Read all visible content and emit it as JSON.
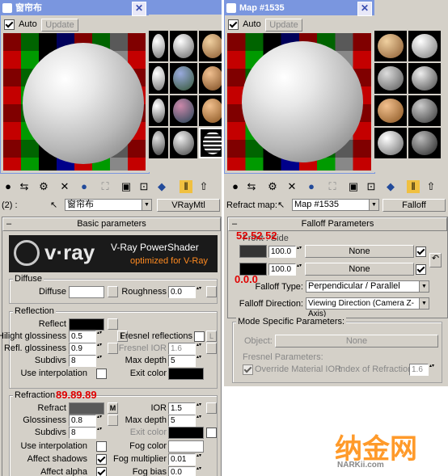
{
  "left": {
    "title": "窗帘布",
    "auto_label": "Auto",
    "update_label": "Update",
    "toolbar_prefix": "(2) :",
    "material_name": "窗帘布",
    "material_type": "VRayMtl",
    "rollout_title": "Basic parameters",
    "vray_banner": {
      "logo": "v·ray",
      "title": "V-Ray PowerShader",
      "subtitle": "optimized for V-Ray"
    },
    "diffuse": {
      "group": "Diffuse",
      "diffuse_label": "Diffuse",
      "roughness_label": "Roughness",
      "roughness": "0.0"
    },
    "reflection": {
      "group": "Reflection",
      "reflect_label": "Reflect",
      "hilight_label": "Hilight glossiness",
      "hilight": "0.5",
      "l_label": "L",
      "fresnel_label": "Fresnel reflections",
      "refl_gloss_label": "Refl. glossiness",
      "refl_gloss": "0.9",
      "fresnel_ior_label": "Fresnel IOR",
      "fresnel_ior": "1.6",
      "subdivs_label": "Subdivs",
      "subdivs": "8",
      "max_depth_label": "Max depth",
      "max_depth": "5",
      "use_interp_label": "Use interpolation",
      "exit_color_label": "Exit color"
    },
    "refraction": {
      "group": "Refraction",
      "annotation": "89.89.89",
      "refract_label": "Refract",
      "m_label": "M",
      "ior_label": "IOR",
      "ior": "1.5",
      "gloss_label": "Glossiness",
      "gloss": "0.8",
      "max_depth_label": "Max depth",
      "max_depth": "5",
      "subdivs_label": "Subdivs",
      "subdivs": "8",
      "exit_color_label": "Exit color",
      "use_interp_label": "Use interpolation",
      "fog_color_label": "Fog color",
      "affect_shadows_label": "Affect shadows",
      "fog_mult_label": "Fog multiplier",
      "fog_mult": "0.01",
      "affect_alpha_label": "Affect alpha",
      "fog_bias_label": "Fog bias",
      "fog_bias": "0.0"
    }
  },
  "right": {
    "title": "Map #1535",
    "auto_label": "Auto",
    "update_label": "Update",
    "refract_map_label": "Refract map:",
    "map_name": "Map #1535",
    "map_type": "Falloff",
    "rollout_title": "Falloff Parameters",
    "front_side_label": "Front : Side",
    "annotation_top": "52.52.52",
    "annotation_bottom": "0.0.0",
    "value1": "100.0",
    "value2": "100.0",
    "none1": "None",
    "none2": "None",
    "falloff_type_label": "Falloff Type:",
    "falloff_type": "Perpendicular / Parallel",
    "falloff_dir_label": "Falloff Direction:",
    "falloff_dir": "Viewing Direction (Camera Z-Axis)",
    "mode_group": "Mode Specific Parameters:",
    "object_label": "Object:",
    "object_value": "None",
    "fresnel_params_label": "Fresnel Parameters:",
    "override_ior_label": "Override Material IOR",
    "ior_label": "Index of Refraction",
    "ior_value": "1.6"
  },
  "watermark": {
    "main": "纳金网",
    "sub": "NARKii.com"
  },
  "colors": {
    "title_bar": "#7a96df",
    "annotation": "#e00000",
    "panel_bg": "#d4d0c8"
  }
}
